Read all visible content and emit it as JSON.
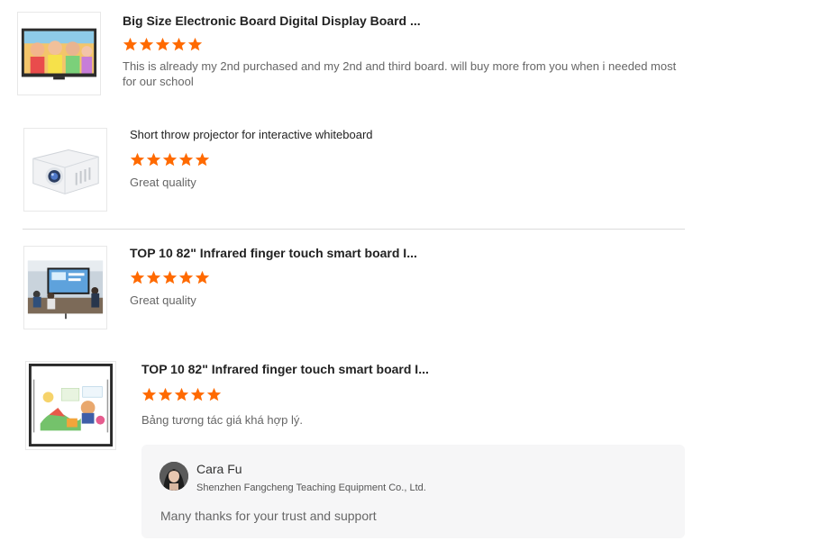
{
  "colors": {
    "star": "#ff6a00",
    "text_muted": "#666666",
    "title": "#222222"
  },
  "reviews": [
    {
      "product_title": "Big Size Electronic Board Digital Display Board ...",
      "rating": 5,
      "text_line1": "This is already my 2nd purchased and my 2nd and third board. will buy more from you when i needed most",
      "text_line2": "for our school",
      "image": "children-classroom-display-image"
    },
    {
      "product_title": "Short throw projector for interactive whiteboard",
      "rating": 5,
      "text_line1": "Great quality",
      "image": "projector-image"
    },
    {
      "product_title": "TOP 10 82\" Infrared finger touch smart board I...",
      "rating": 5,
      "text_line1": "Great quality",
      "image": "meeting-room-board-image"
    },
    {
      "product_title": "TOP 10 82\" Infrared finger touch smart board I...",
      "rating": 5,
      "text_line1": "Bảng tương tác giá khá hợp lý.",
      "image": "whiteboard-illustration-image"
    }
  ],
  "reply": {
    "name": "Cara Fu",
    "company": "Shenzhen Fangcheng Teaching Equipment Co., Ltd.",
    "text": "Many thanks for your trust and support",
    "avatar": "avatar-photo"
  }
}
